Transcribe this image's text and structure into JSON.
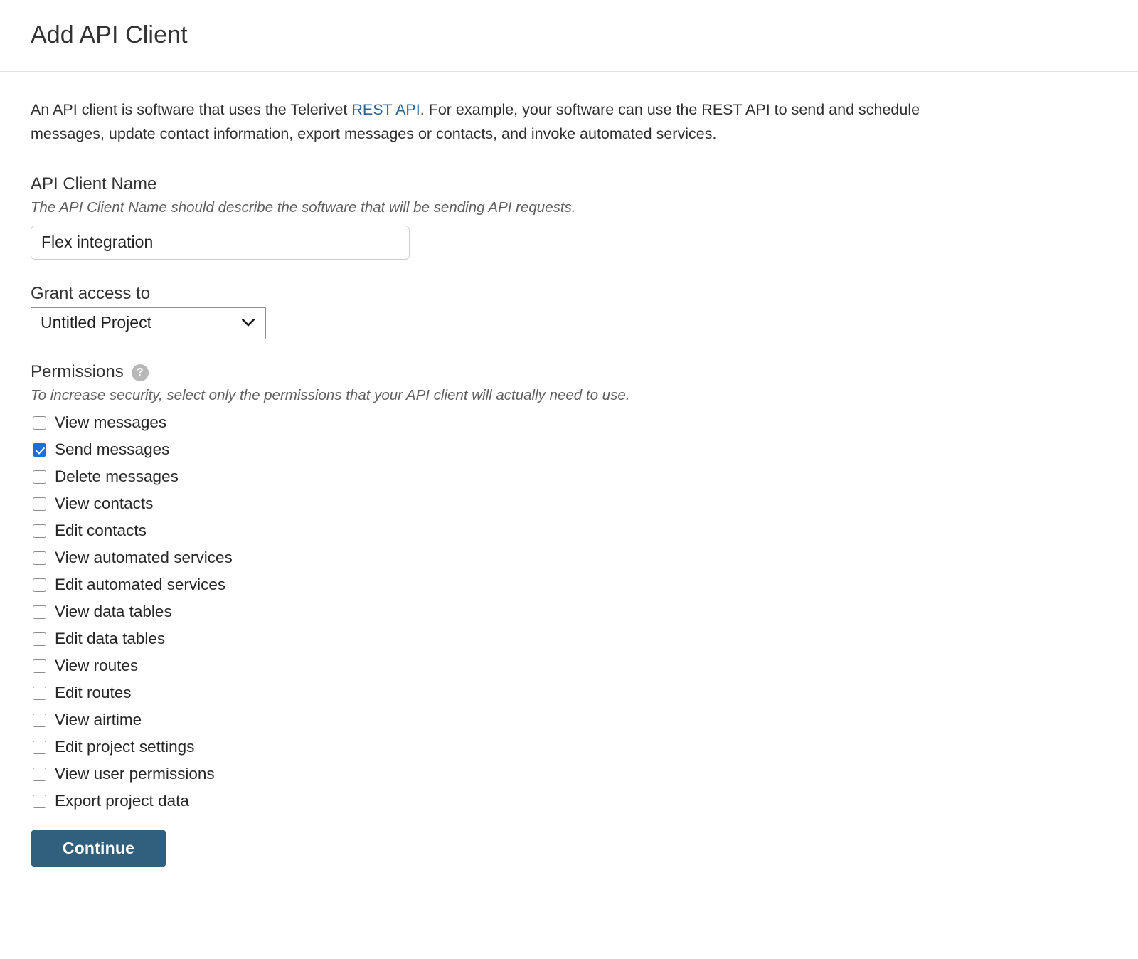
{
  "header": {
    "title": "Add API Client"
  },
  "intro": {
    "before_link": "An API client is software that uses the Telerivet ",
    "link_text": "REST API",
    "after_link": ". For example, your software can use the REST API to send and schedule messages, update contact information, export messages or contacts, and invoke automated services.",
    "link_color": "#2a6496"
  },
  "client_name": {
    "label": "API Client Name",
    "hint": "The API Client Name should describe the software that will be sending API requests.",
    "value": "Flex integration",
    "placeholder": ""
  },
  "grant_access": {
    "label": "Grant access to",
    "selected": "Untitled Project",
    "options": [
      "Untitled Project"
    ],
    "chevron_icon": "chevron-down-icon"
  },
  "permissions": {
    "label": "Permissions",
    "help_icon": "help-icon",
    "help_glyph": "?",
    "hint": "To increase security, select only the permissions that your API client will actually need to use.",
    "checked_color": "#1a6fd8",
    "items": [
      {
        "label": "View messages",
        "checked": false
      },
      {
        "label": "Send messages",
        "checked": true
      },
      {
        "label": "Delete messages",
        "checked": false
      },
      {
        "label": "View contacts",
        "checked": false
      },
      {
        "label": "Edit contacts",
        "checked": false
      },
      {
        "label": "View automated services",
        "checked": false
      },
      {
        "label": "Edit automated services",
        "checked": false
      },
      {
        "label": "View data tables",
        "checked": false
      },
      {
        "label": "Edit data tables",
        "checked": false
      },
      {
        "label": "View routes",
        "checked": false
      },
      {
        "label": "Edit routes",
        "checked": false
      },
      {
        "label": "View airtime",
        "checked": false
      },
      {
        "label": "Edit project settings",
        "checked": false
      },
      {
        "label": "View user permissions",
        "checked": false
      },
      {
        "label": "Export project data",
        "checked": false
      }
    ]
  },
  "actions": {
    "continue_label": "Continue",
    "continue_color": "#31607f"
  }
}
